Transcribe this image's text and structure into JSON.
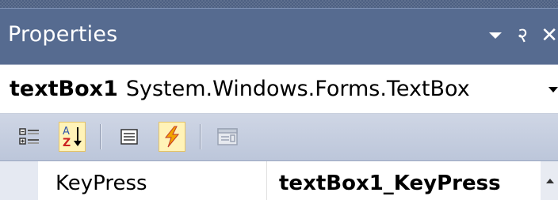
{
  "panel": {
    "title": "Properties",
    "pin_glyph": "२",
    "close_glyph": "✕"
  },
  "object_selector": {
    "name": "textBox1",
    "type": "System.Windows.Forms.TextBox"
  },
  "toolbar": {
    "buttons": [
      {
        "icon": "categorized-icon",
        "active": false
      },
      {
        "icon": "alphabetical-sort-icon",
        "active": true
      },
      {
        "icon": "properties-icon",
        "active": false
      },
      {
        "icon": "events-lightning-icon",
        "active": true
      },
      {
        "icon": "property-pages-icon",
        "active": false
      }
    ]
  },
  "grid": {
    "rows": [
      {
        "name": "KeyPress",
        "value": "textBox1_KeyPress"
      }
    ]
  },
  "colors": {
    "title_bar": "#566b90",
    "active_button": "#fff3b8",
    "lightning": "#f2a400"
  }
}
